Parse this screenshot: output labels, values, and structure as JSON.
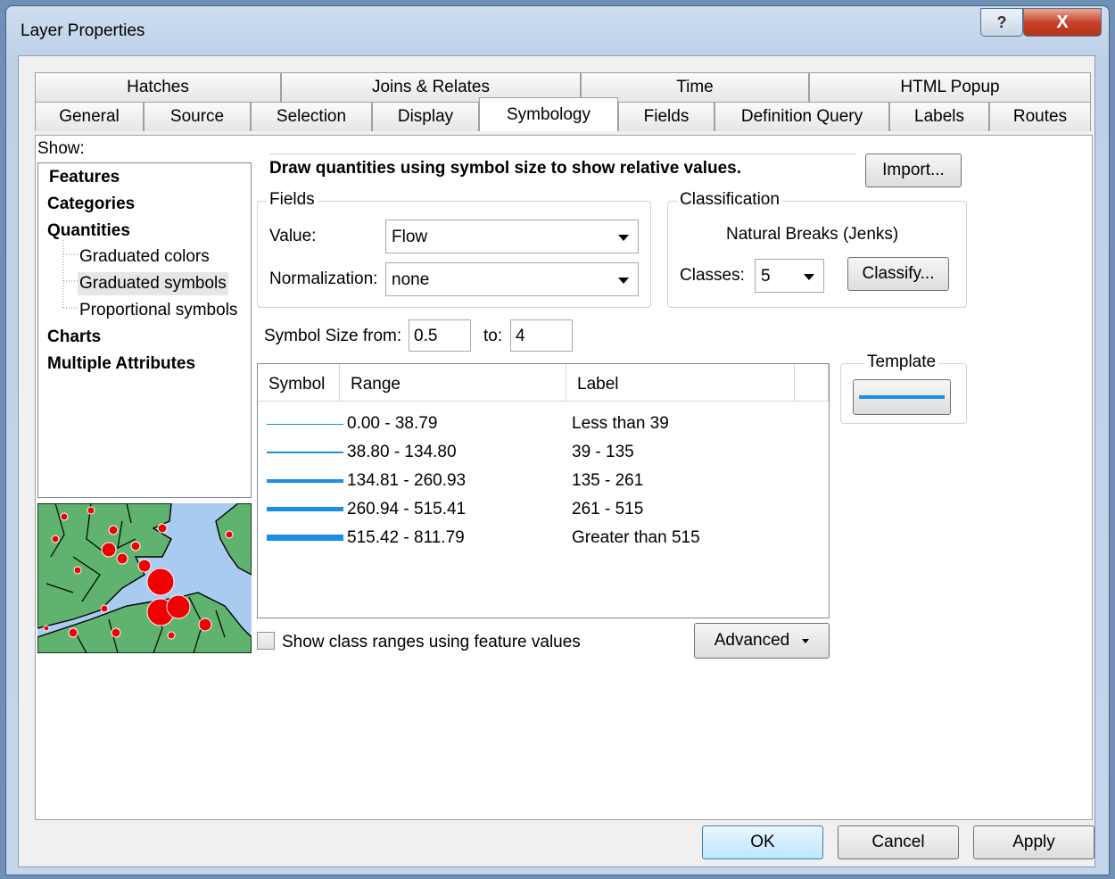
{
  "window": {
    "title": "Layer Properties",
    "help_label": "?",
    "close_label": "X"
  },
  "tabs_row1": [
    "Hatches",
    "Joins & Relates",
    "Time",
    "HTML Popup"
  ],
  "tabs_row2": [
    "General",
    "Source",
    "Selection",
    "Display",
    "Symbology",
    "Fields",
    "Definition Query",
    "Labels",
    "Routes"
  ],
  "active_tab": "Symbology",
  "show": {
    "label": "Show:",
    "items": [
      {
        "label": "Features",
        "bold": true
      },
      {
        "label": "Categories",
        "bold": true
      },
      {
        "label": "Quantities",
        "bold": true
      },
      {
        "label": "Graduated colors",
        "bold": false
      },
      {
        "label": "Graduated symbols",
        "bold": false,
        "selected": true
      },
      {
        "label": "Proportional symbols",
        "bold": false
      },
      {
        "label": "Charts",
        "bold": true
      },
      {
        "label": "Multiple Attributes",
        "bold": true
      }
    ]
  },
  "description": "Draw quantities using symbol size to show relative values.",
  "import_label": "Import...",
  "fields": {
    "group_label": "Fields",
    "value_label": "Value:",
    "value": "Flow",
    "normalization_label": "Normalization:",
    "normalization": "none"
  },
  "classification": {
    "group_label": "Classification",
    "method": "Natural Breaks (Jenks)",
    "classes_label": "Classes:",
    "classes": "5",
    "classify_label": "Classify..."
  },
  "symbol_size": {
    "from_label": "Symbol Size from:",
    "from": "0.5",
    "to_label": "to:",
    "to": "4"
  },
  "template": {
    "label": "Template",
    "color": "#1a8fe3"
  },
  "table": {
    "headers": [
      "Symbol",
      "Range",
      "Label"
    ],
    "rows": [
      {
        "range": "0.00 - 38.79",
        "label": "Less than 39",
        "width": 0.5
      },
      {
        "range": "38.80 - 134.80",
        "label": "39 - 135",
        "width": 1.4
      },
      {
        "range": "134.81 - 260.93",
        "label": "135 - 261",
        "width": 2.2
      },
      {
        "range": "260.94 - 515.41",
        "label": "261 - 515",
        "width": 3.1
      },
      {
        "range": "515.42 - 811.79",
        "label": "Greater than 515",
        "width": 4
      }
    ]
  },
  "show_ranges": {
    "label": "Show class ranges using feature values",
    "checked": false
  },
  "advanced_label": "Advanced",
  "footer": {
    "ok": "OK",
    "cancel": "Cancel",
    "apply": "Apply"
  },
  "colors": {
    "symbol_line": "#1a8fe3",
    "map_land": "#5fb36e",
    "map_water": "#a9cbef",
    "map_symbol": "#f00000"
  }
}
